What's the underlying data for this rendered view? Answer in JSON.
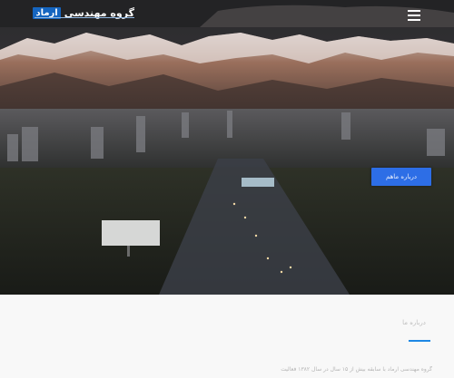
{
  "header": {
    "logo_text": "گروه مهندسی",
    "logo_accent": "ارماد"
  },
  "hero": {
    "cta_label": "درباره ماهم"
  },
  "about": {
    "title": "درباره ما",
    "text": "گروه مهندسی ارماد با سابقه بیش از ۱۵ سال در سال ۱۳۸۲ فعالیت"
  },
  "colors": {
    "accent": "#2d6ee6",
    "underline": "#1e88e5",
    "section_bg": "#f8f8f8"
  },
  "icons": {
    "menu": "hamburger-menu-icon"
  }
}
